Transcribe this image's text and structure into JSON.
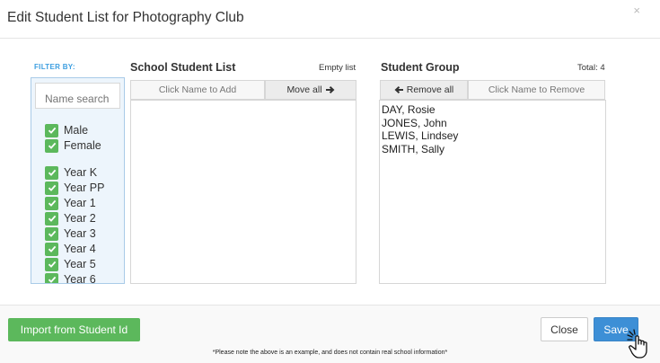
{
  "modal": {
    "title": "Edit Student List for Photography Club",
    "close_glyph": "×"
  },
  "filter": {
    "label": "FILTER BY:",
    "search_placeholder": "Name search",
    "gender": [
      "Male",
      "Female"
    ],
    "years": [
      "Year K",
      "Year PP",
      "Year 1",
      "Year 2",
      "Year 3",
      "Year 4",
      "Year 5",
      "Year 6"
    ]
  },
  "school_list": {
    "title": "School Student List",
    "status": "Empty list",
    "hint": "Click Name to Add",
    "move_all": "Move all",
    "move_all_icon": "arrow-right-icon",
    "students": []
  },
  "group": {
    "title": "Student Group",
    "total": "Total: 4",
    "remove_all": "Remove all",
    "remove_all_icon": "arrow-left-icon",
    "hint": "Click Name to Remove",
    "students": [
      "DAY, Rosie",
      "JONES, John",
      "LEWIS, Lindsey",
      "SMITH, Sally"
    ]
  },
  "footer": {
    "import": "Import from Student Id",
    "close": "Close",
    "save": "Save",
    "note": "*Please note the above is an example, and does not contain real school information*"
  },
  "colors": {
    "accent_green": "#5cb85c",
    "primary_blue": "#3d8fd6",
    "filter_label_blue": "#3c9ee0"
  }
}
